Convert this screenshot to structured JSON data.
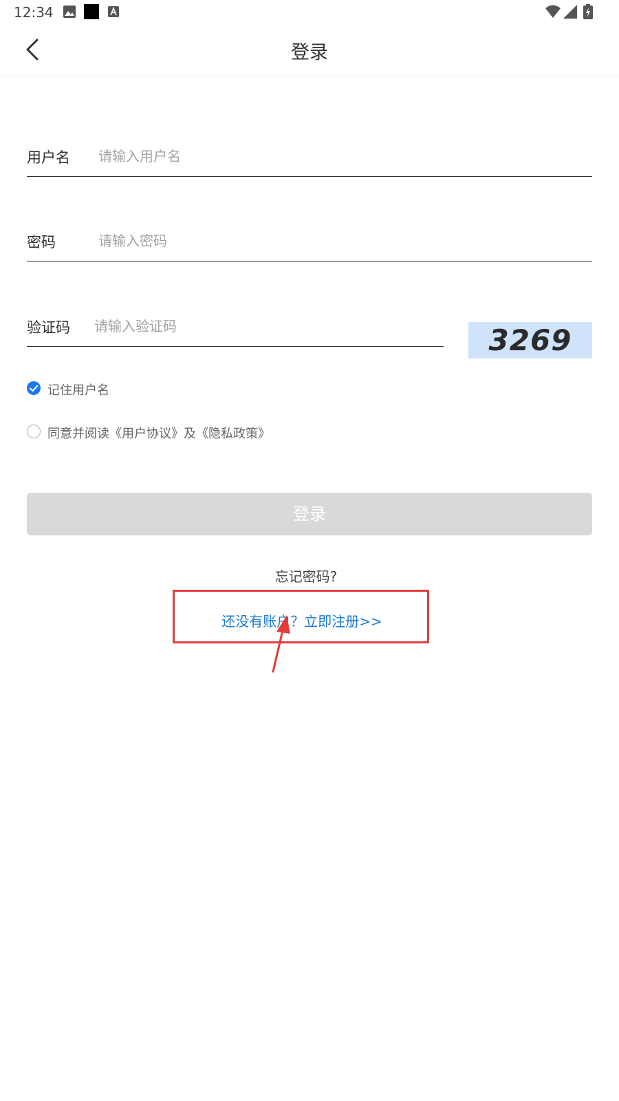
{
  "status_bar": {
    "time": "12:34",
    "left_icons": [
      "photo-icon",
      "black-square-icon",
      "font-icon"
    ],
    "right_icons": [
      "wifi-icon",
      "signal-icon",
      "battery-icon"
    ]
  },
  "nav": {
    "title": "登录",
    "back_icon": "chevron-left-icon"
  },
  "form": {
    "username": {
      "label": "用户名",
      "placeholder": "请输入用户名",
      "value": ""
    },
    "password": {
      "label": "密码",
      "placeholder": "请输入密码",
      "value": ""
    },
    "captcha": {
      "label": "验证码",
      "placeholder": "请输入验证码",
      "value": "",
      "code": "3269",
      "background": "#cfe3fb"
    }
  },
  "options": {
    "remember": {
      "label": "记住用户名",
      "checked": true
    },
    "agree": {
      "label": "同意并阅读《用户协议》及《隐私政策》",
      "checked": false
    }
  },
  "actions": {
    "login_label": "登录",
    "forgot_label": "忘记密码?",
    "register_label": "还没有账户？立即注册>>"
  },
  "colors": {
    "accent": "#1e78f0",
    "link": "#1a7bd6",
    "login_disabled": "#d9d9d9",
    "annotation": "#e43c3c"
  }
}
